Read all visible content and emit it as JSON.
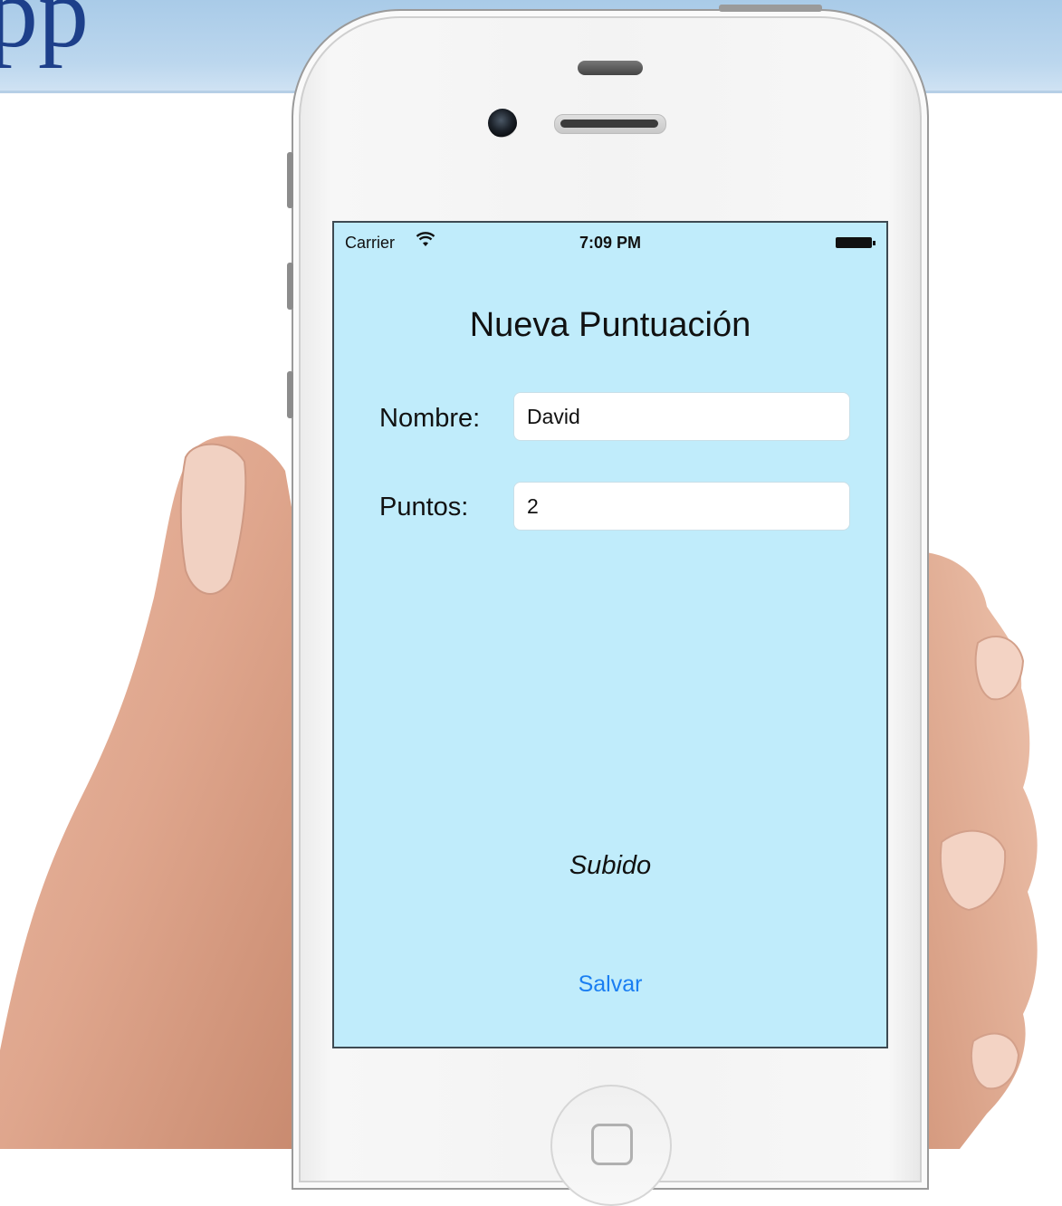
{
  "banner": {
    "text": "pp"
  },
  "status_bar": {
    "carrier": "Carrier",
    "time": "7:09 PM"
  },
  "screen": {
    "title": "Nueva Puntuación",
    "name_label": "Nombre:",
    "name_value": "David",
    "points_label": "Puntos:",
    "points_value": "2",
    "status_text": "Subido",
    "save_label": "Salvar"
  },
  "colors": {
    "screen_background": "#c0ecfb",
    "button_text": "#1a7ef2",
    "banner": "#bcd7ee",
    "banner_text": "#1d3f8a"
  },
  "icons": [
    "wifi-icon",
    "battery-icon",
    "front-camera-icon",
    "earpiece-speaker-icon",
    "home-button-icon"
  ]
}
